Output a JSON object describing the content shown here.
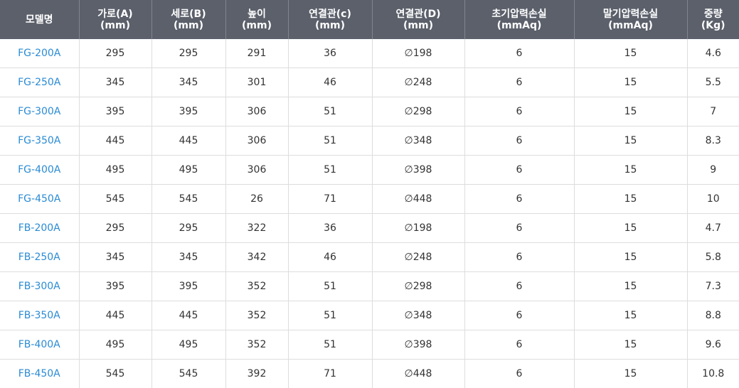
{
  "accent_color": "#2a8bd4",
  "header_bg_color": "#5b606b",
  "table": {
    "columns": [
      {
        "line1": "모델명",
        "line2": ""
      },
      {
        "line1": "가로(A)",
        "line2": "(mm)"
      },
      {
        "line1": "세로(B)",
        "line2": "(mm)"
      },
      {
        "line1": "높이",
        "line2": "(mm)"
      },
      {
        "line1": "연결관(c)",
        "line2": "(mm)"
      },
      {
        "line1": "연결관(D)",
        "line2": "(mm)"
      },
      {
        "line1": "초기압력손실",
        "line2": "(mmAq)"
      },
      {
        "line1": "말기압력손실",
        "line2": "(mmAq)"
      },
      {
        "line1": "중량",
        "line2": "(Kg)"
      }
    ],
    "rows": [
      [
        "FG-200A",
        "295",
        "295",
        "291",
        "36",
        "∅198",
        "6",
        "15",
        "4.6"
      ],
      [
        "FG-250A",
        "345",
        "345",
        "301",
        "46",
        "∅248",
        "6",
        "15",
        "5.5"
      ],
      [
        "FG-300A",
        "395",
        "395",
        "306",
        "51",
        "∅298",
        "6",
        "15",
        "7"
      ],
      [
        "FG-350A",
        "445",
        "445",
        "306",
        "51",
        "∅348",
        "6",
        "15",
        "8.3"
      ],
      [
        "FG-400A",
        "495",
        "495",
        "306",
        "51",
        "∅398",
        "6",
        "15",
        "9"
      ],
      [
        "FG-450A",
        "545",
        "545",
        "26",
        "71",
        "∅448",
        "6",
        "15",
        "10"
      ],
      [
        "FB-200A",
        "295",
        "295",
        "322",
        "36",
        "∅198",
        "6",
        "15",
        "4.7"
      ],
      [
        "FB-250A",
        "345",
        "345",
        "342",
        "46",
        "∅248",
        "6",
        "15",
        "5.8"
      ],
      [
        "FB-300A",
        "395",
        "395",
        "352",
        "51",
        "∅298",
        "6",
        "15",
        "7.3"
      ],
      [
        "FB-350A",
        "445",
        "445",
        "352",
        "51",
        "∅348",
        "6",
        "15",
        "8.8"
      ],
      [
        "FB-400A",
        "495",
        "495",
        "352",
        "51",
        "∅398",
        "6",
        "15",
        "9.6"
      ],
      [
        "FB-450A",
        "545",
        "545",
        "392",
        "71",
        "∅448",
        "6",
        "15",
        "10.8"
      ]
    ]
  }
}
